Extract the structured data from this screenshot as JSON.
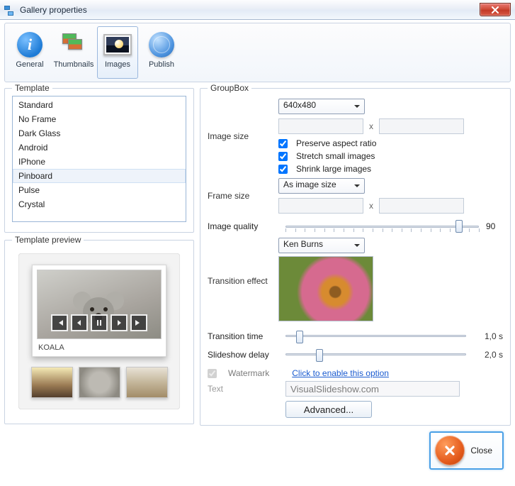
{
  "window": {
    "title": "Gallery properties"
  },
  "tabs": [
    {
      "label": "General"
    },
    {
      "label": "Thumbnails"
    },
    {
      "label": "Images"
    },
    {
      "label": "Publish"
    }
  ],
  "template": {
    "legend": "Template",
    "items": [
      "Standard",
      "No Frame",
      "Dark Glass",
      "Android",
      "IPhone",
      "Pinboard",
      "Pulse",
      "Crystal"
    ],
    "selected": "Pinboard"
  },
  "preview": {
    "legend": "Template preview",
    "caption": "KOALA"
  },
  "group": {
    "legend": "GroupBox",
    "imageSizeLabel": "Image size",
    "imageSizeValue": "640x480",
    "preserve": "Preserve aspect ratio",
    "stretch": "Stretch small images",
    "shrink": "Shrink large images",
    "frameSizeLabel": "Frame size",
    "frameSizeValue": "As image size",
    "imageQualityLabel": "Image quality",
    "imageQualityValue": "90",
    "transitionEffectLabel": "Transition effect",
    "transitionEffectValue": "Ken Burns",
    "transitionTimeLabel": "Transition time",
    "transitionTimeValue": "1,0 s",
    "slideshowDelayLabel": "Slideshow delay",
    "slideshowDelayValue": "2,0 s",
    "watermarkLabel": "Watermark",
    "watermarkLink": "Click to enable this option",
    "textLabel": "Text",
    "textValue": "VisualSlideshow.com",
    "advancedLabel": "Advanced..."
  },
  "footer": {
    "closeLabel": "Close"
  }
}
